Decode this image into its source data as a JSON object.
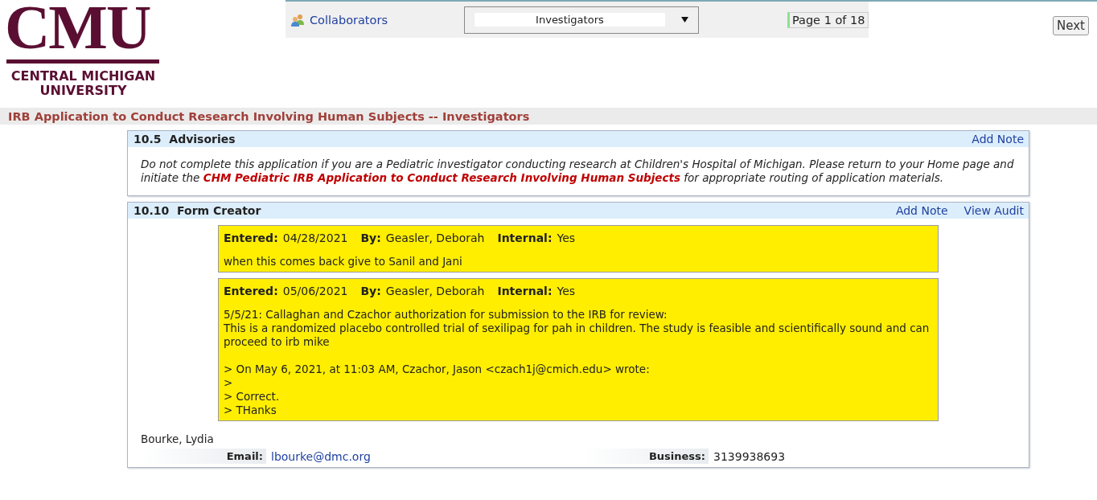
{
  "logo": {
    "wordmark": "CMU",
    "line_1": "CENTRAL MICHIGAN",
    "line_2": "UNIVERSITY"
  },
  "toolbar": {
    "link": "Collaborators",
    "select": {
      "value": "Investigators"
    },
    "page_indicator": "Page 1 of 18",
    "next_button": "Next"
  },
  "page_title": "IRB Application to Conduct Research Involving Human Subjects -- Investigators",
  "sections": [
    {
      "number": "10.5",
      "title": "Advisories",
      "actions": [
        "Add Note"
      ],
      "advisory": "Do not complete this application if you are a Pediatric investigator conducting research at Children's Hospital of Michigan.  Please return to your Home page and initiate the **CHM Pediatric IRB Application to Conduct Research Involving Human Subjects** for appropriate routing of application materials."
    },
    {
      "number": "10.10",
      "title": "Form Creator",
      "actions": [
        "Add Note",
        "View Audit"
      ],
      "notes": [
        {
          "entered_label": "Entered:",
          "entered": "04/28/2021",
          "by_label": "By:",
          "by": "Geasler, Deborah",
          "internal_label": "Internal:",
          "internal": "Yes",
          "body": "when this comes back give to Sanil and Jani"
        },
        {
          "entered_label": "Entered:",
          "entered": "05/06/2021",
          "by_label": "By:",
          "by": "Geasler, Deborah",
          "internal_label": "Internal:",
          "internal": "Yes",
          "body": "5/5/21: Callaghan and Czachor authorization for submission to the IRB for review:\nThis is a randomized placebo controlled trial of sexilipag for pah in children. The study is feasible and scientifically sound and can proceed to irb mike\n\n> On May 6, 2021, at 11:03 AM, Czachor, Jason <czach1j@cmich.edu> wrote:\n>\n> Correct.\n> THanks"
        }
      ],
      "person": {
        "name": "Bourke, Lydia",
        "fields": [
          {
            "label": "Email:",
            "value": "lbourke@dmc.org",
            "kind": "link"
          },
          {
            "label": "Business:",
            "value": "3139938693",
            "kind": "text"
          }
        ]
      }
    }
  ]
}
